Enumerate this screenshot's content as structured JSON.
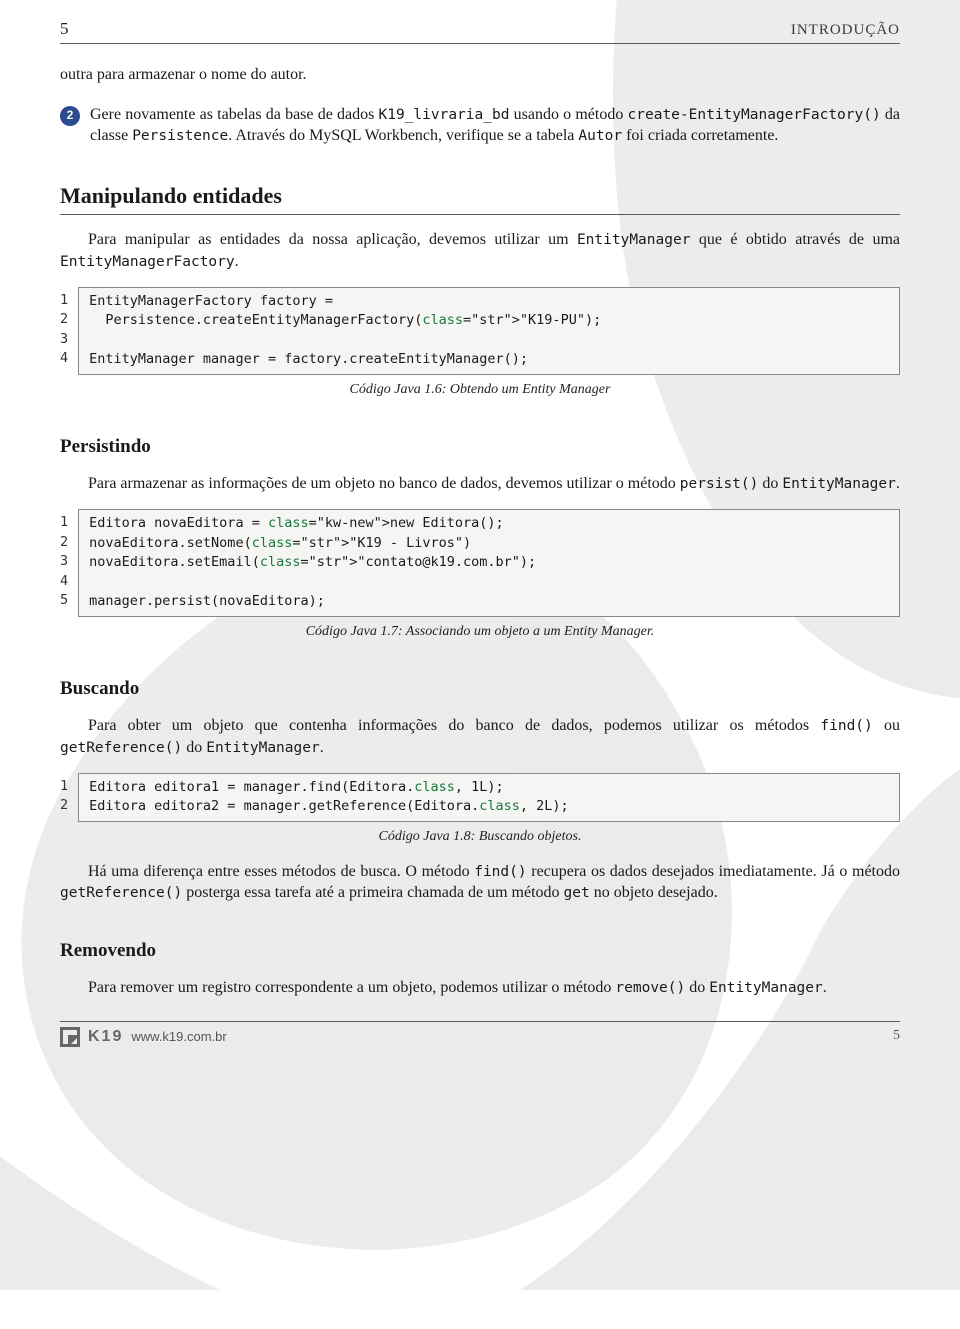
{
  "header": {
    "page_number_top": "5",
    "chapter": "INTRODUÇÃO"
  },
  "intro": {
    "p1": "outra para armazenar o nome do autor.",
    "step_number": "2",
    "p2a": "Gere novamente as tabelas da base de dados ",
    "p2_code1": "K19_livraria_bd",
    "p2b": " usando o método ",
    "p2_code2": "create-EntityManagerFactory()",
    "p2c": " da classe ",
    "p2_code3": "Persistence",
    "p2d": ". Através do MySQL Workbench, verifique se a tabela ",
    "p2_code4": "Autor",
    "p2e": " foi criada corretamente."
  },
  "section1": {
    "title": "Manipulando entidades",
    "p_a": "Para manipular as entidades da nossa aplicação, devemos utilizar um ",
    "p_code1": "EntityManager",
    "p_b": " que é obtido através de uma ",
    "p_code2": "EntityManagerFactory",
    "p_c": "."
  },
  "code1": {
    "ln": "1\n2\n3\n4",
    "lines": [
      "EntityManagerFactory factory =",
      "  Persistence.createEntityManagerFactory(\"K19-PU\");",
      "",
      "EntityManager manager = factory.createEntityManager();"
    ],
    "caption": "Código Java 1.6: Obtendo um Entity Manager"
  },
  "section2": {
    "title": "Persistindo",
    "p_a": "Para armazenar as informações de um objeto no banco de dados, devemos utilizar o método ",
    "p_code1": "persist()",
    "p_b": " do ",
    "p_code2": "EntityManager",
    "p_c": "."
  },
  "code2": {
    "ln": "1\n2\n3\n4\n5",
    "lines": [
      "Editora novaEditora = new Editora();",
      "novaEditora.setNome(\"K19 - Livros\")",
      "novaEditora.setEmail(\"contato@k19.com.br\");",
      "",
      "manager.persist(novaEditora);"
    ],
    "caption": "Código Java 1.7: Associando um objeto a um Entity Manager."
  },
  "section3": {
    "title": "Buscando",
    "p_a": "Para obter um objeto que contenha informações do banco de dados, podemos utilizar os métodos ",
    "p_code1": "find()",
    "p_b": " ou ",
    "p_code2": "getReference()",
    "p_c": " do ",
    "p_code3": "EntityManager",
    "p_d": "."
  },
  "code3": {
    "ln": "1\n2",
    "lines": [
      "Editora editora1 = manager.find(Editora.class, 1L);",
      "Editora editora2 = manager.getReference(Editora.class, 2L);"
    ],
    "caption": "Código Java 1.8: Buscando objetos."
  },
  "post3": {
    "p_a": "Há uma diferença entre esses métodos de busca. O método ",
    "p_code1": "find()",
    "p_b": " recupera os dados desejados imediatamente. Já o método ",
    "p_code2": "getReference()",
    "p_c": " posterga essa tarefa até a primeira chamada de um método ",
    "p_code3": "get",
    "p_d": " no objeto desejado."
  },
  "section4": {
    "title": "Removendo",
    "p_a": "Para remover um registro correspondente a um objeto, podemos utilizar o método ",
    "p_code1": "remove()",
    "p_b": " do ",
    "p_code2": "EntityManager",
    "p_c": "."
  },
  "footer": {
    "logo_text": "K19",
    "url": "www.k19.com.br",
    "page_number_bottom": "5"
  }
}
